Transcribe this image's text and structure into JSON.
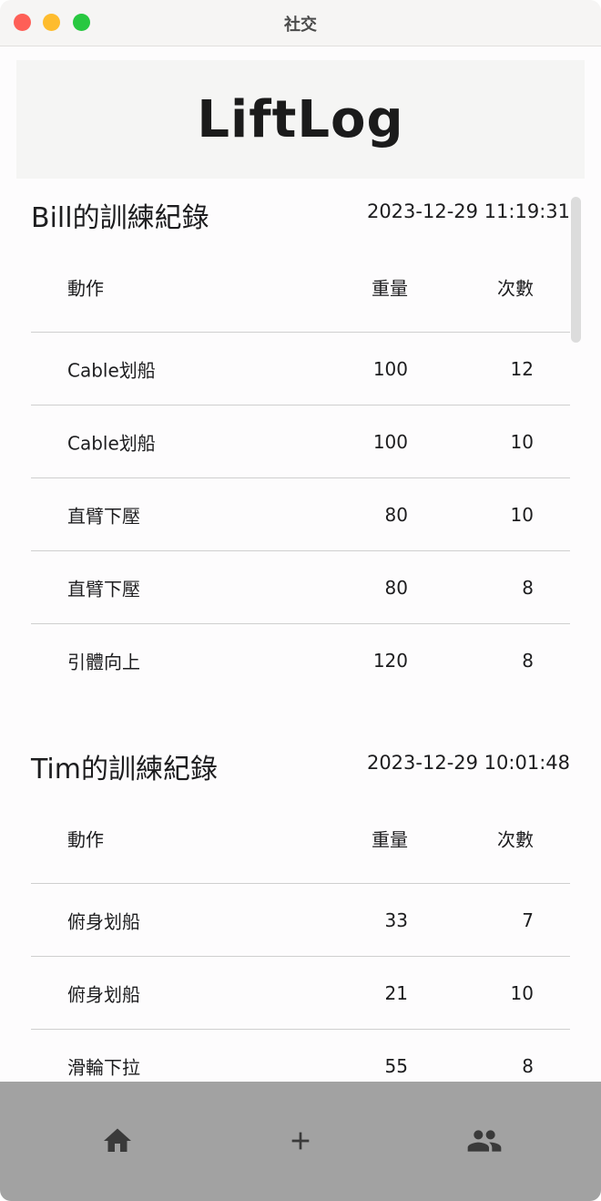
{
  "window": {
    "title": "社交"
  },
  "app": {
    "title": "LiftLog"
  },
  "sessions": [
    {
      "title": "Bill的訓練紀錄",
      "time": "2023-12-29 11:19:31",
      "headers": {
        "name": "動作",
        "weight": "重量",
        "reps": "次數"
      },
      "rows": [
        {
          "name": "Cable划船",
          "weight": "100",
          "reps": "12"
        },
        {
          "name": "Cable划船",
          "weight": "100",
          "reps": "10"
        },
        {
          "name": "直臂下壓",
          "weight": "80",
          "reps": "10"
        },
        {
          "name": "直臂下壓",
          "weight": "80",
          "reps": "8"
        },
        {
          "name": "引體向上",
          "weight": "120",
          "reps": "8"
        }
      ]
    },
    {
      "title": "Tim的訓練紀錄",
      "time": "2023-12-29 10:01:48",
      "headers": {
        "name": "動作",
        "weight": "重量",
        "reps": "次數"
      },
      "rows": [
        {
          "name": "俯身划船",
          "weight": "33",
          "reps": "7"
        },
        {
          "name": "俯身划船",
          "weight": "21",
          "reps": "10"
        },
        {
          "name": "滑輪下拉",
          "weight": "55",
          "reps": "8"
        }
      ]
    }
  ],
  "nav": {
    "items": [
      {
        "icon": "home-icon"
      },
      {
        "icon": "plus-icon"
      },
      {
        "icon": "people-icon"
      }
    ]
  },
  "colors": {
    "close": "#fe5f57",
    "minimize": "#febc2e",
    "zoom": "#28c840",
    "nav_bg": "#a2a2a2",
    "icon": "#3a3a3a"
  }
}
